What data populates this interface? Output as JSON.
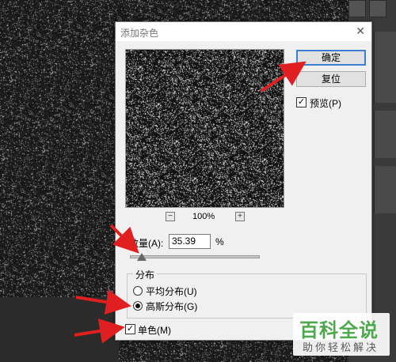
{
  "dialog": {
    "title": "添加杂色",
    "close_glyph": "✕",
    "ok_label": "确定",
    "reset_label": "复位",
    "preview_label": "预览(P)",
    "preview_checked": true,
    "zoom_out_glyph": "−",
    "zoom_in_glyph": "+",
    "zoom_value": "100%",
    "amount_label": "数量(A):",
    "amount_value": "35.39",
    "amount_unit": "%",
    "amount_fraction": 0.0885,
    "distribution_group": "分布",
    "uniform_label": "平均分布(U)",
    "gaussian_label": "高斯分布(G)",
    "selected_distribution": "gaussian",
    "mono_label": "单色(M)",
    "mono_checked": true
  },
  "watermark": {
    "main": "百科全说",
    "sub": "助你轻松解决"
  },
  "colors": {
    "accent": "#3c7fd1",
    "arrow": "#e02020",
    "watermark_green": "#4ea84c"
  }
}
